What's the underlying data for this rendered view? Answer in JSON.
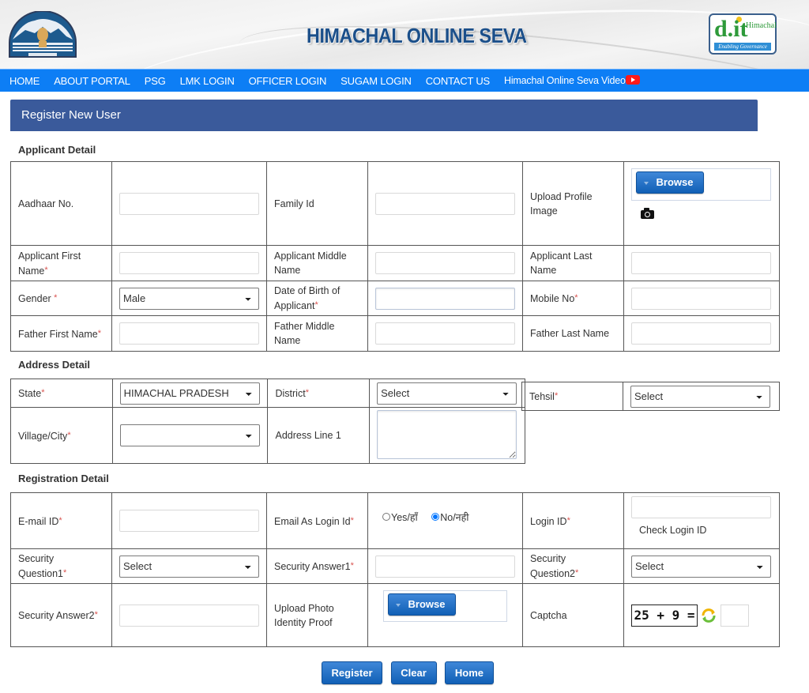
{
  "header": {
    "site_title": "HIMACHAL ONLINE SEVA",
    "logo_left": "himachal-pradesh-emblem",
    "logo_right": {
      "main": "d.it",
      "sub": "Himachal",
      "tagline": "Enabling Governance"
    }
  },
  "nav": {
    "items": [
      "HOME",
      "ABOUT PORTAL",
      "PSG",
      "LMK LOGIN",
      "OFFICER LOGIN",
      "SUGAM LOGIN",
      "CONTACT US"
    ],
    "video_link": "Himachal Online Seva Video",
    "video_icon": "youtube-icon"
  },
  "panel": {
    "title": "Register New User"
  },
  "colors": {
    "nav_bg": "#0d7ef5",
    "panel_bg": "#3a5a9b",
    "button_blue": "#1a6bc4",
    "required": "#d9534f"
  },
  "applicant": {
    "section_title": "Applicant Detail",
    "aadhaar_label": "Aadhaar No.",
    "aadhaar_value": "",
    "family_id_label": "Family Id",
    "family_id_value": "",
    "upload_profile_label": "Upload Profile Image",
    "browse_label": "Browse",
    "first_name_label": "Applicant First Name",
    "middle_name_label": "Applicant Middle Name",
    "last_name_label": "Applicant Last Name",
    "gender_label": "Gender ",
    "gender_value": "Male",
    "dob_label": "Date of Birth of Applicant",
    "mobile_label": "Mobile No",
    "father_first_label": "Father First Name",
    "father_middle_label": "Father Middle Name",
    "father_last_label": "Father Last Name",
    "required_mark": "*"
  },
  "address": {
    "section_title": "Address Detail",
    "state_label": "State",
    "state_value": "HIMACHAL PRADESH",
    "district_label": "District",
    "district_value": "Select",
    "tehsil_label": "Tehsil",
    "tehsil_value": "Select",
    "village_label": "Village/City",
    "village_value": "",
    "address1_label": "Address Line 1",
    "address1_value": ""
  },
  "registration": {
    "section_title": "Registration Detail",
    "email_label": "E-mail ID",
    "email_as_login_label": "Email As Login Id",
    "radio_yes": "Yes/हाँ",
    "radio_no": "No/नही",
    "radio_selected": "no",
    "login_id_label": "Login ID",
    "check_login_id": "Check Login ID",
    "sq1_label": "Security Question1",
    "sq1_value": "Select",
    "sa1_label": "Security Answer1",
    "sq2_label": "Security Question2",
    "sq2_value": "Select",
    "sa2_label": "Security Answer2",
    "upload_id_label": "Upload Photo Identity Proof",
    "browse_label": "Browse",
    "captcha_label": "Captcha",
    "captcha_text": "25 + 9 =",
    "captcha_answer": ""
  },
  "actions": {
    "register": "Register",
    "clear": "Clear",
    "home": "Home"
  }
}
